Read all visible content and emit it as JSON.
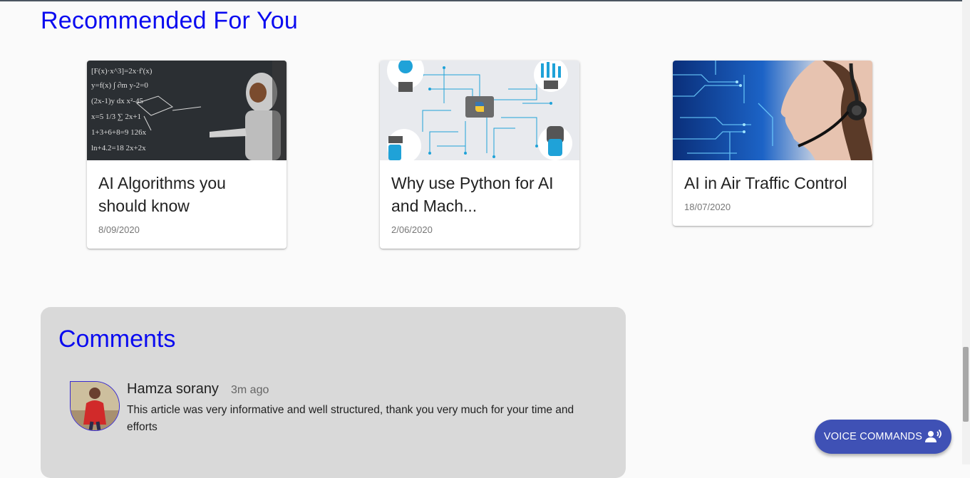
{
  "recommended": {
    "heading": "Recommended For You",
    "cards": [
      {
        "title_line1": "AI Algorithms you",
        "title_line2": "should know",
        "date": "8/09/2020",
        "image": "robot-at-chalkboard"
      },
      {
        "title_line1": "Why use Python for AI",
        "title_line2": "and Mach...",
        "date": "2/06/2020",
        "image": "python-circuit-robots"
      },
      {
        "title_line1": "AI in Air Traffic Control",
        "title_line2": "",
        "date": "18/07/2020",
        "image": "woman-headset-circuit"
      }
    ]
  },
  "comments": {
    "heading": "Comments",
    "items": [
      {
        "author": "Hamza sorany",
        "time": "3m ago",
        "text": "This article was very informative and well structured, thank you very much for your time and efforts"
      }
    ]
  },
  "voice_button": {
    "label": "VOICE COMMANDS",
    "icon": "voice-person-icon",
    "color": "#3f51b5"
  },
  "colors": {
    "heading": "#0b0bf0",
    "comments_bg": "#d9d9d9",
    "page_bg": "#fafafa"
  }
}
